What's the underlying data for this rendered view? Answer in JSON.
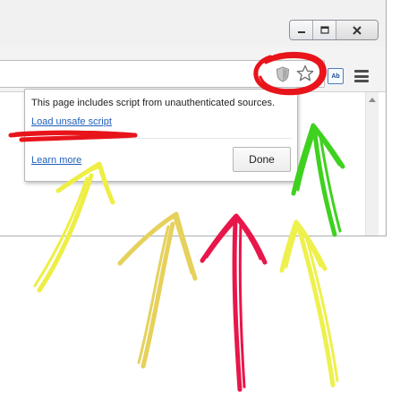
{
  "window_controls": {
    "minimize_icon": "minimize-icon",
    "maximize_icon": "maximize-icon",
    "close_icon": "close-icon"
  },
  "toolbar": {
    "shield_icon": "shield-warning-icon",
    "bookmark_icon": "star-icon",
    "extension_label": "Ab",
    "menu_icon": "hamburger-menu-icon"
  },
  "security_bubble": {
    "message": "This page includes script from unauthenticated sources.",
    "load_unsafe_link": "Load unsafe script",
    "learn_more_link": "Learn more",
    "done_button": "Done"
  },
  "annotations": {
    "circle_color": "#e8141b",
    "underline_color": "#e8141b",
    "arrow_colors": [
      "#eeee44",
      "#e5d15c",
      "#e8164a",
      "#eef04c",
      "#3fd11f"
    ]
  }
}
